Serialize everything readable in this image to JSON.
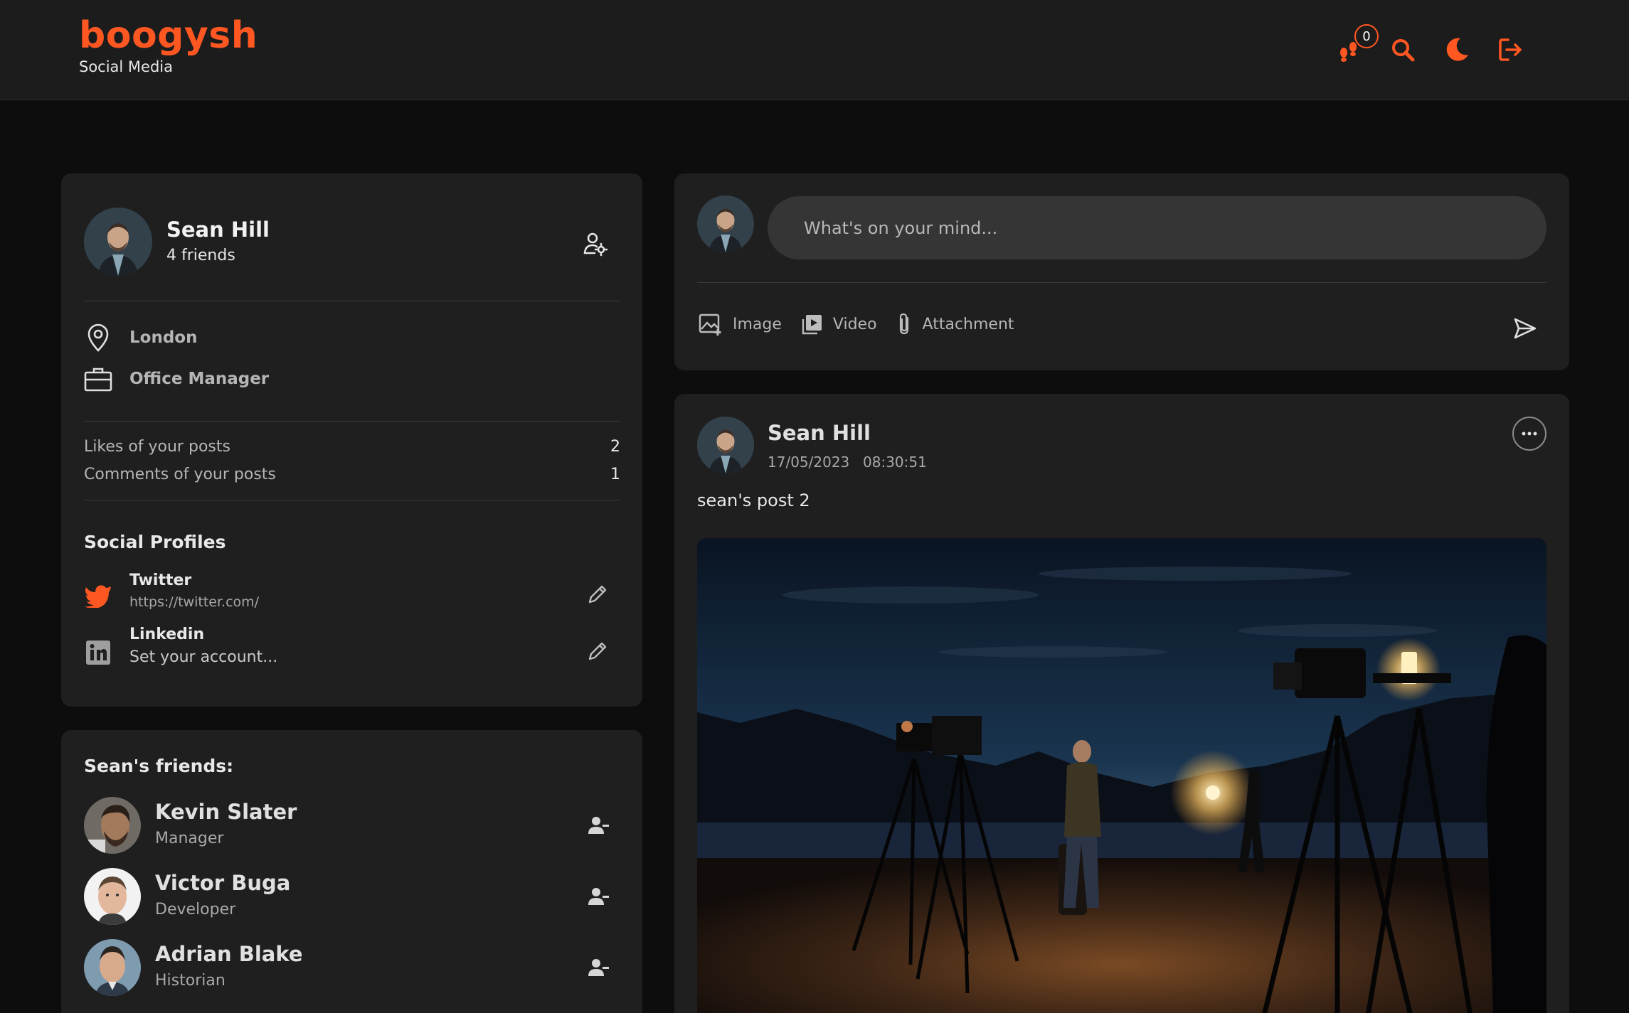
{
  "brand": {
    "name": "boogysh",
    "subtitle": "Social Media"
  },
  "header": {
    "notification_count": "0",
    "accent": "#ff5722"
  },
  "profile": {
    "name": "Sean Hill",
    "friends_label": "4 friends",
    "location": "London",
    "occupation": "Office Manager",
    "stats": [
      {
        "label": "Likes of your posts",
        "value": "2"
      },
      {
        "label": "Comments of your posts",
        "value": "1"
      }
    ],
    "social_title": "Social Profiles",
    "social": [
      {
        "name": "Twitter",
        "value": "https://twitter.com/"
      },
      {
        "name": "Linkedin",
        "value": "Set your account..."
      }
    ]
  },
  "friends": {
    "title": "Sean's friends:",
    "items": [
      {
        "name": "Kevin Slater",
        "role": "Manager"
      },
      {
        "name": "Victor Buga",
        "role": "Developer"
      },
      {
        "name": "Adrian Blake",
        "role": "Historian"
      }
    ]
  },
  "compose": {
    "placeholder": "What's on your mind...",
    "image_label": "Image",
    "video_label": "Video",
    "attachment_label": "Attachment"
  },
  "post": {
    "author": "Sean Hill",
    "date": "17/05/2023",
    "time": "08:30:51",
    "text": "sean's post 2"
  }
}
